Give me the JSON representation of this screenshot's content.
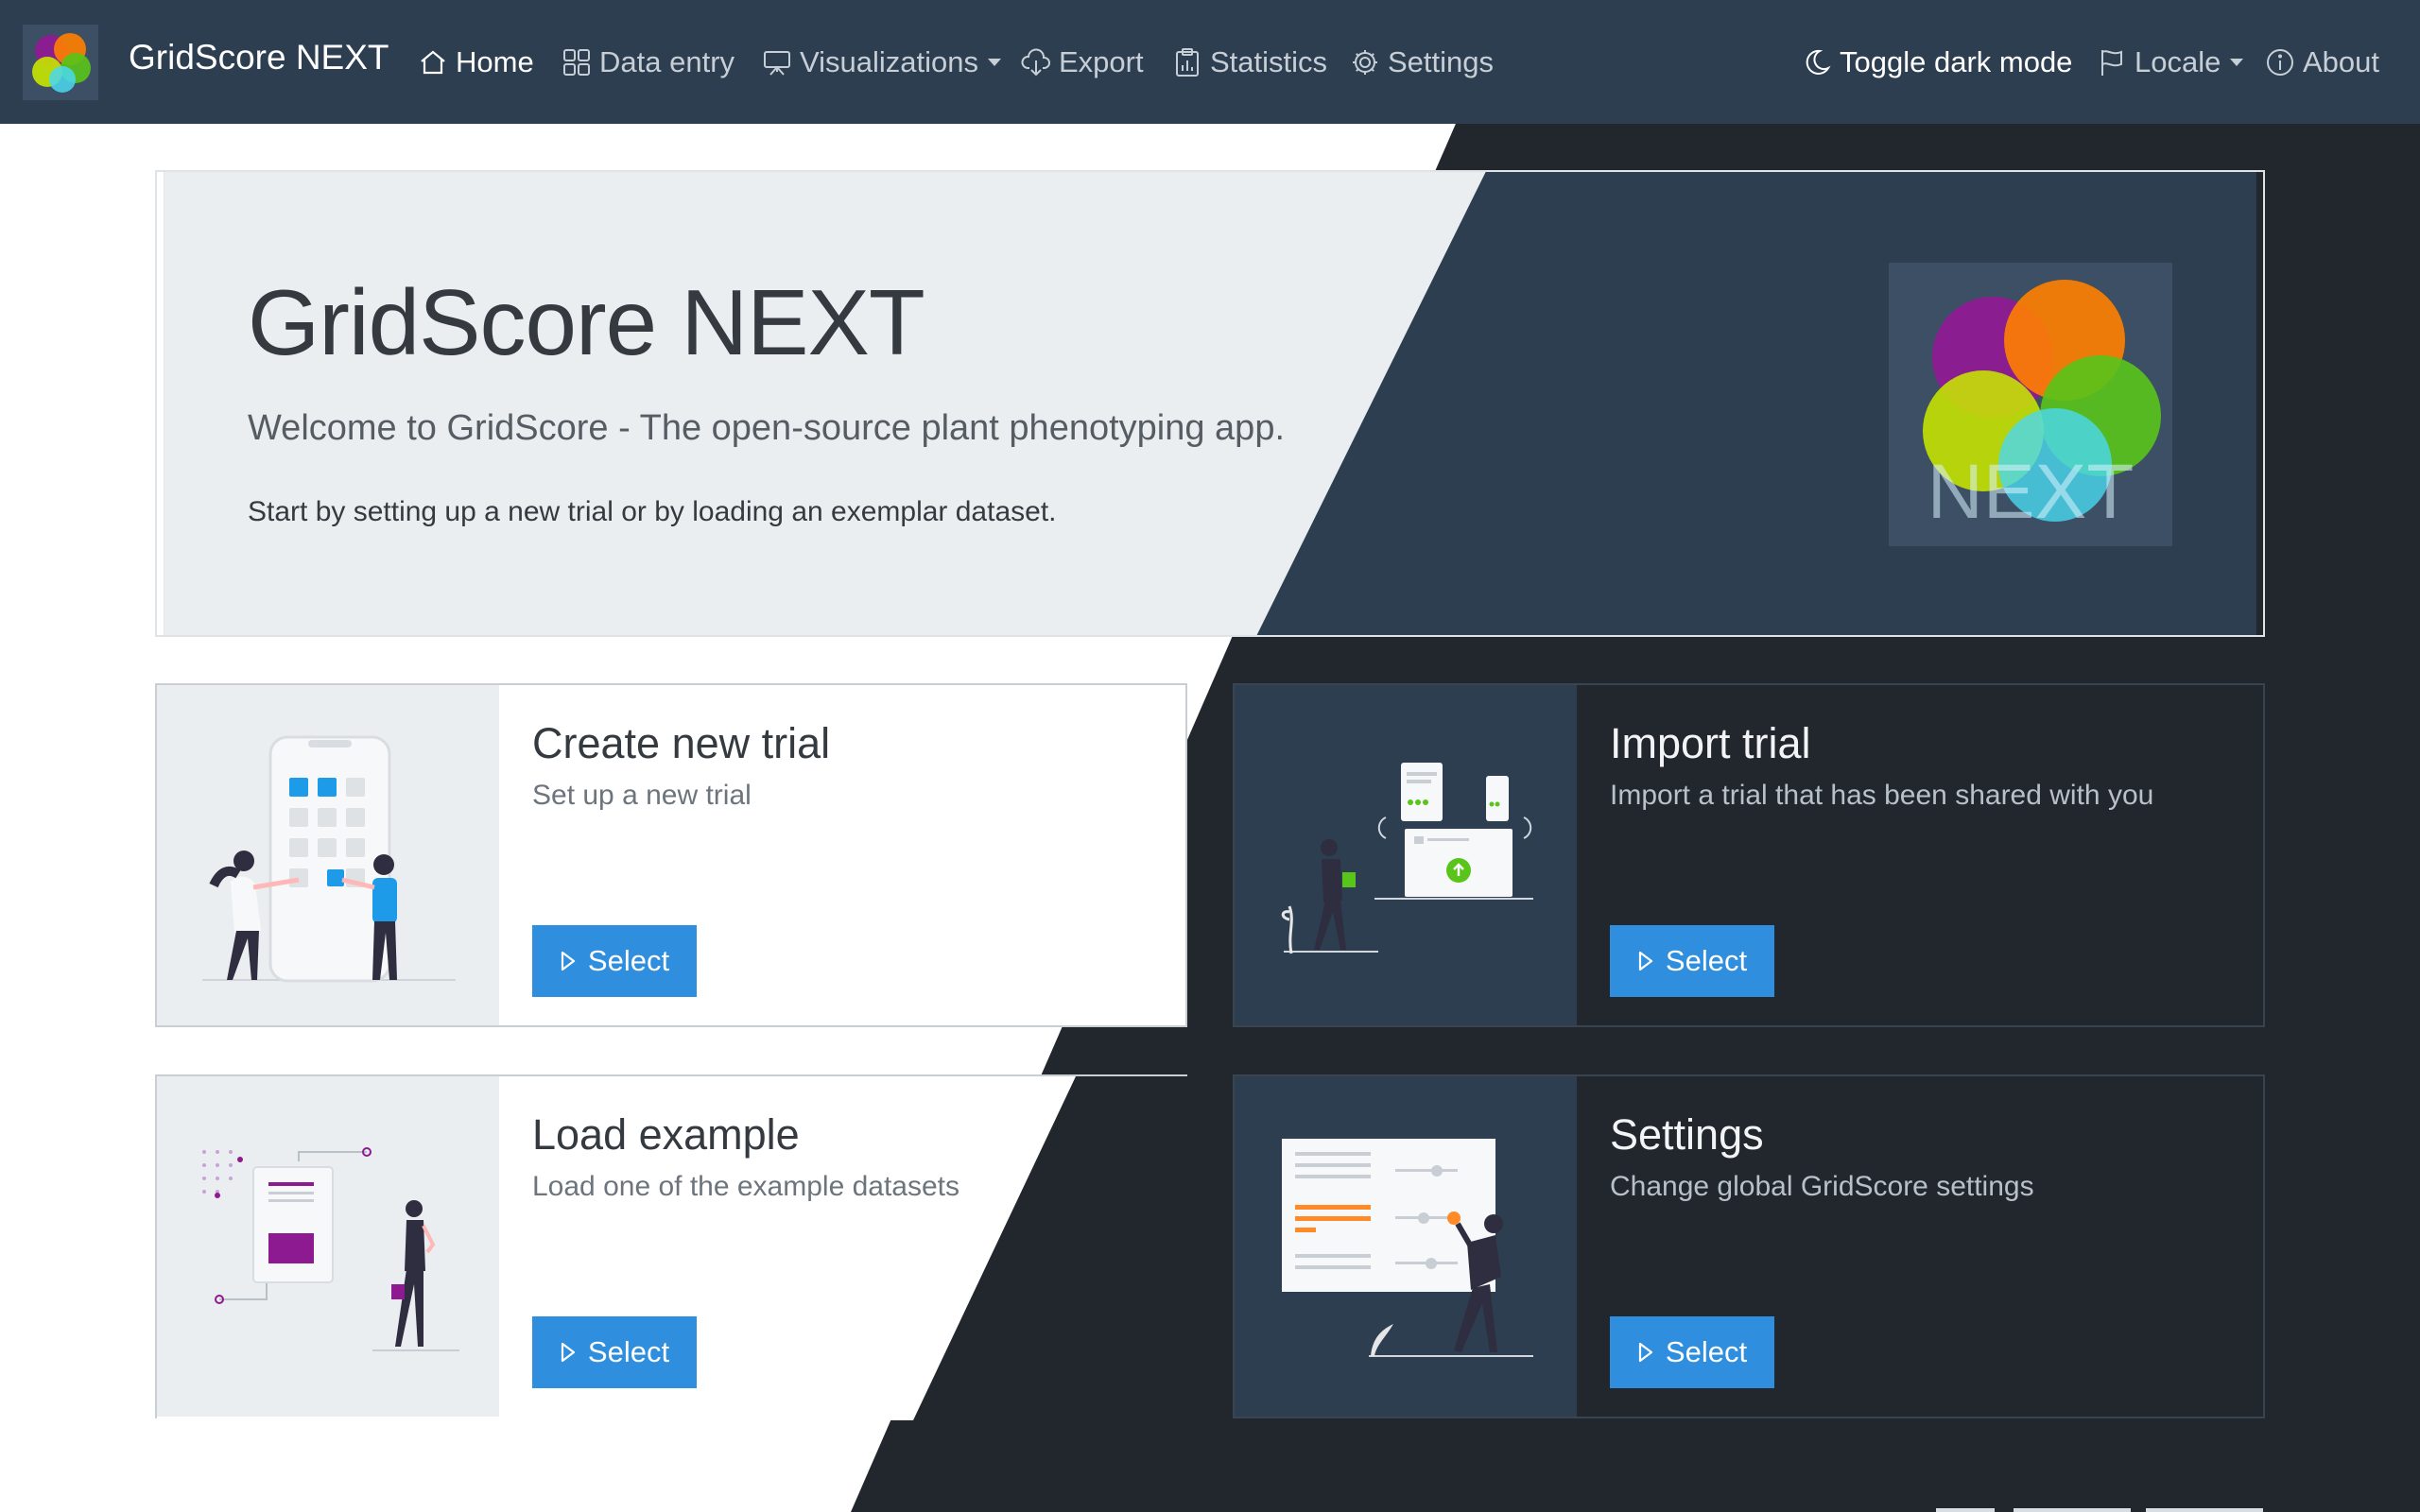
{
  "navbar": {
    "brand": "GridScore NEXT",
    "items": [
      {
        "label": "Home",
        "icon": "house-icon",
        "active": true
      },
      {
        "label": "Data entry",
        "icon": "grid-icon"
      },
      {
        "label": "Visualizations",
        "icon": "easel-icon",
        "dropdown": true
      },
      {
        "label": "Export",
        "icon": "cloud-download-icon"
      },
      {
        "label": "Statistics",
        "icon": "clipboard-data-icon"
      },
      {
        "label": "Settings",
        "icon": "gear-icon"
      }
    ],
    "right": [
      {
        "label": "Toggle dark mode",
        "icon": "moon-icon"
      },
      {
        "label": "Locale",
        "icon": "flag-icon",
        "dropdown": true
      },
      {
        "label": "About",
        "icon": "info-circle-icon"
      }
    ]
  },
  "hero": {
    "title": "GridScore NEXT",
    "subtitle": "Welcome to GridScore - The open-source plant phenotyping app.",
    "description": "Start by setting up a new trial or by loading an exemplar dataset.",
    "logo_text": "NEXT"
  },
  "cards": [
    {
      "title": "Create new trial",
      "subtitle": "Set up a new trial",
      "button": "Select",
      "illustration": "people-at-phone-illustration"
    },
    {
      "title": "Import trial",
      "subtitle": "Import a trial that has been shared with you",
      "button": "Select",
      "illustration": "sync-devices-illustration"
    },
    {
      "title": "Load example",
      "subtitle": "Load one of the example datasets",
      "button": "Select",
      "illustration": "woman-with-document-illustration"
    },
    {
      "title": "Settings",
      "subtitle": "Change global GridScore settings",
      "button": "Select",
      "illustration": "person-adjusting-sliders-illustration"
    }
  ],
  "colors": {
    "navbar": "#2c3e50",
    "accent": "#2f8fde",
    "dark_bg": "#22272e",
    "light_panel": "#ebeef0"
  }
}
